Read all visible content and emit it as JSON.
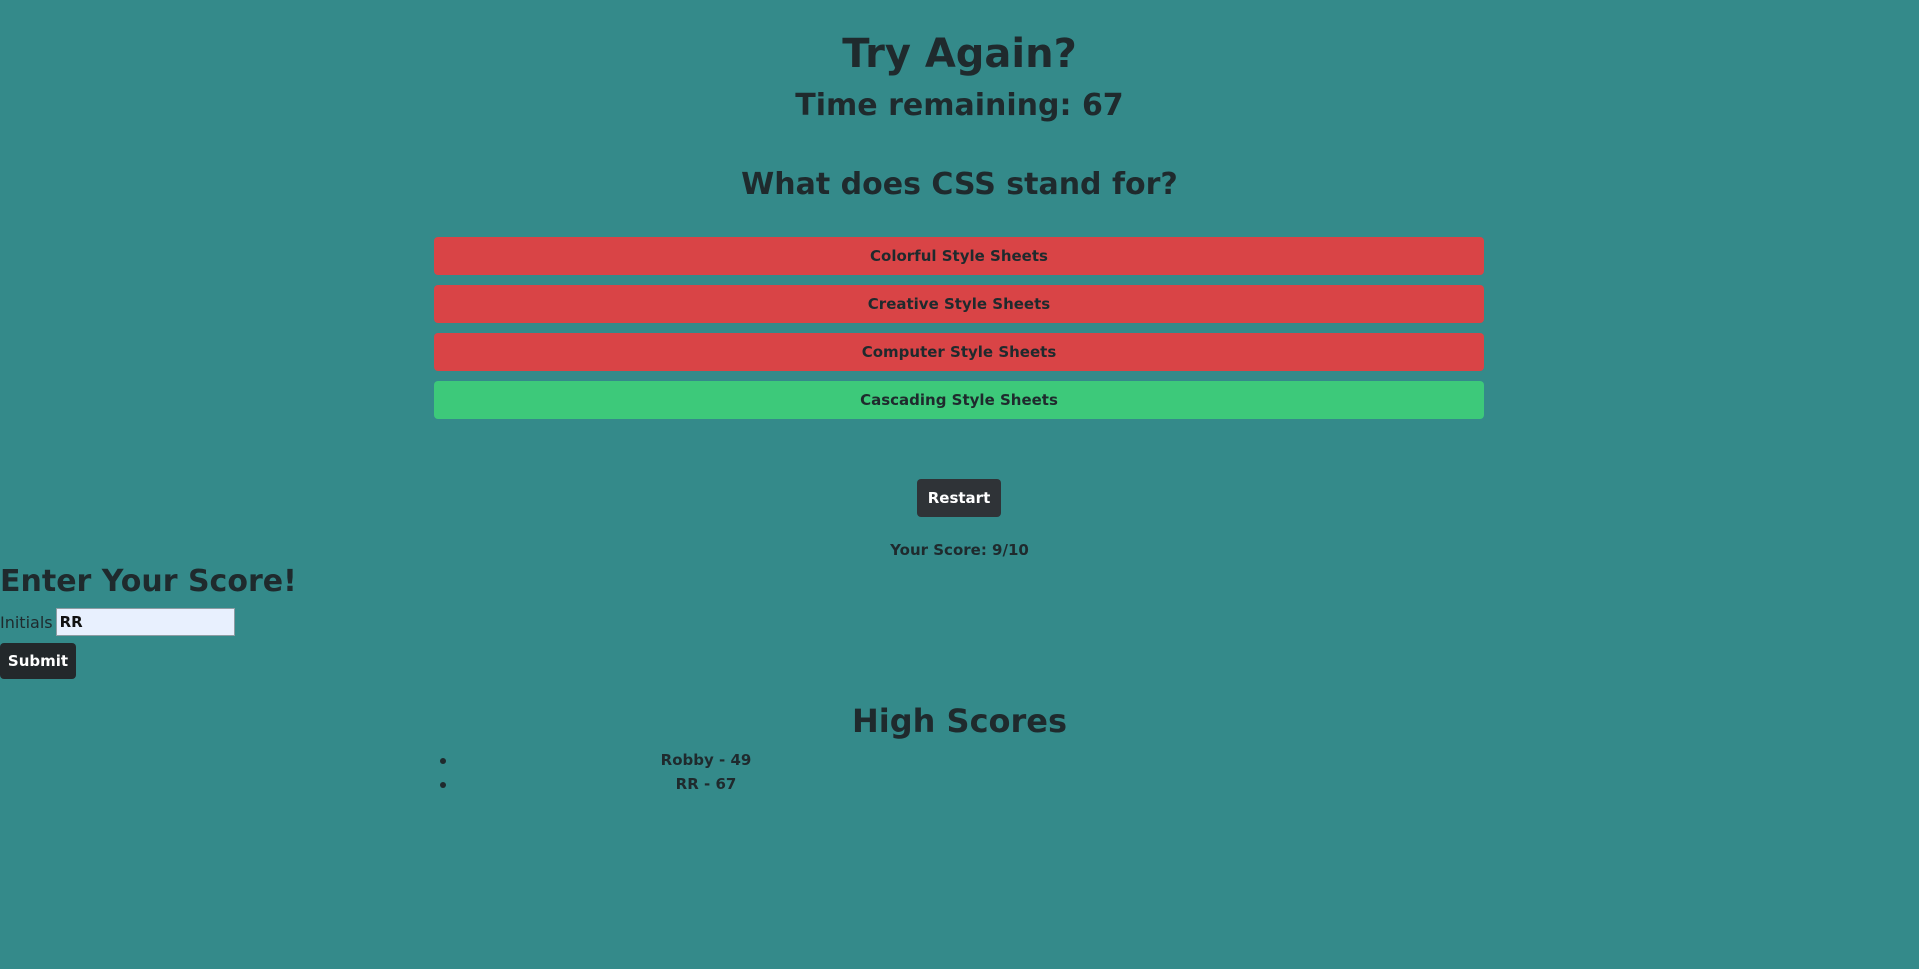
{
  "header": {
    "title": "Try Again?",
    "timer": "Time remaining: 67"
  },
  "quiz": {
    "question": "What does CSS stand for?",
    "answers": [
      {
        "label": "Colorful Style Sheets",
        "state": "wrong",
        "color": "#d94446"
      },
      {
        "label": "Creative Style Sheets",
        "state": "wrong",
        "color": "#d94446"
      },
      {
        "label": "Computer Style Sheets",
        "state": "wrong",
        "color": "#d94446"
      },
      {
        "label": "Cascading Style Sheets",
        "state": "correct",
        "color": "#3dc97a"
      }
    ],
    "restart_label": "Restart",
    "score": "Your Score: 9/10"
  },
  "entry": {
    "title": "Enter Your Score!",
    "initials_label": "Initials",
    "initials_value": "RR",
    "submit_label": "Submit"
  },
  "high_scores": {
    "title": "High Scores",
    "items": [
      "Robby - 49",
      "RR - 67"
    ]
  },
  "colors": {
    "background": "#348a8a",
    "text": "#1f2a2d",
    "wrong": "#d94446",
    "correct": "#3dc97a",
    "button": "#2f3337"
  }
}
